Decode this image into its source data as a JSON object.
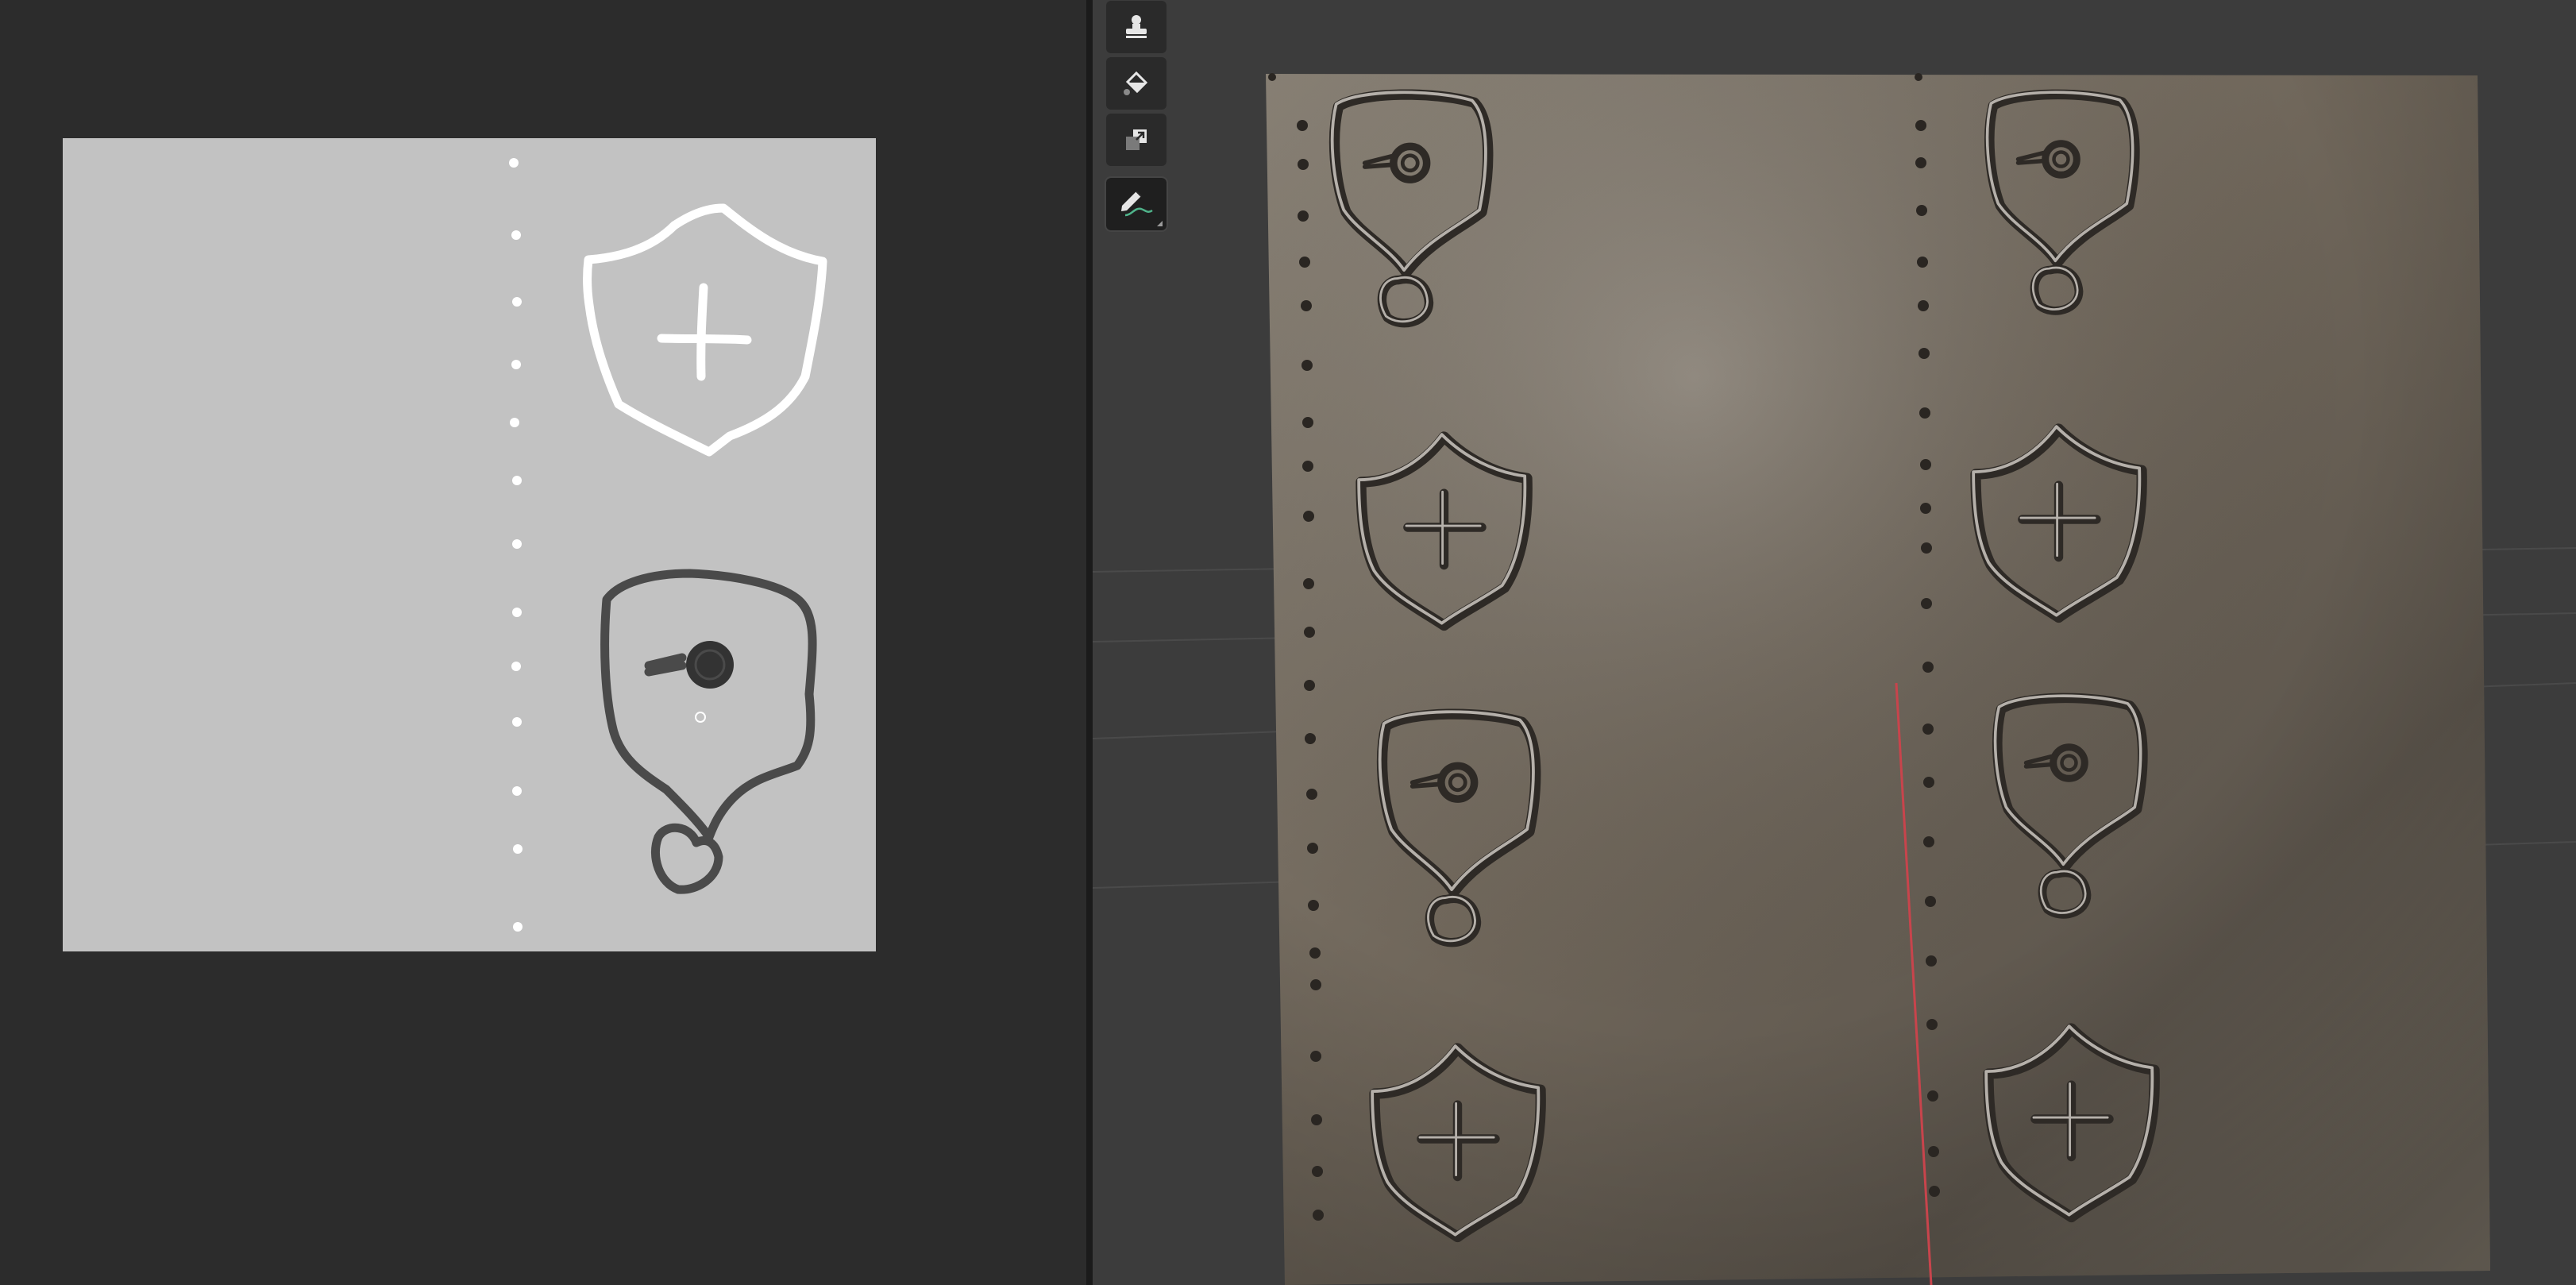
{
  "editor_2d": {
    "canvas": {
      "background": "#c2c2c2",
      "stroke_white": "#ffffff",
      "stroke_dark": "#4a4a4a",
      "dot_color": "#ffffff"
    },
    "icons": [
      "shield-plus-icon",
      "pin-eye-icon",
      "cursor-circle-icon"
    ]
  },
  "viewport_3d": {
    "background": "#3c3c3c",
    "tools": [
      {
        "name": "stamp-tool",
        "icon": "stamp-icon",
        "active": false
      },
      {
        "name": "fill-tool",
        "icon": "paint-bucket-icon",
        "active": false
      },
      {
        "name": "clone-tool",
        "icon": "clone-icon",
        "active": false
      },
      {
        "name": "annotate-tool",
        "icon": "pencil-annotate-icon",
        "active": true
      }
    ],
    "plane": {
      "color": "#7a7063",
      "emboss_icons": [
        "shield-plus-icon",
        "pin-eye-icon"
      ]
    },
    "axis_x_color": "#c8444c"
  }
}
